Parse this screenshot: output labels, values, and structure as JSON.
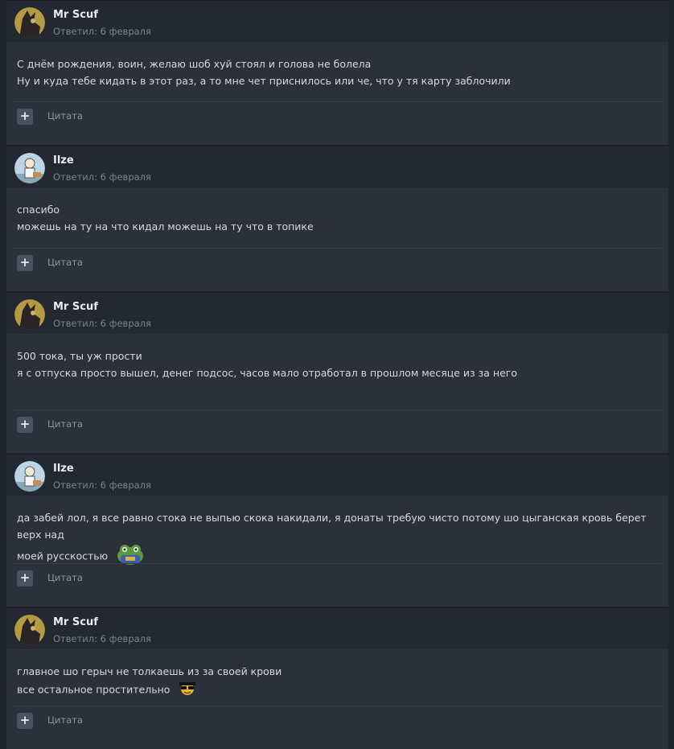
{
  "posts": [
    {
      "author": "Mr Scuf",
      "avatar": "dark-avatar",
      "meta": "Ответил: 6 февраля",
      "lines": [
        "С днём рождения, воин, желаю шоб хуй стоял и голова не болела",
        "Ну и куда тебе кидать в этот раз, а то мне чет приснилось или че, что у тя карту заблочили"
      ],
      "plus_label": "+",
      "quote_label": "Цитата"
    },
    {
      "author": "Ilze",
      "avatar": "cartoon-avatar",
      "meta": "Ответил: 6 февраля",
      "lines": [
        "спасибо",
        "можешь на ту на что кидал можешь на ту что в топике"
      ],
      "plus_label": "+",
      "quote_label": "Цитата"
    },
    {
      "author": "Mr Scuf",
      "avatar": "dark-avatar",
      "meta": "Ответил: 6 февраля",
      "lines": [
        "500 тока, ты уж прости",
        "я с отпуска просто вышел, денег подсос, часов мало отработал в прошлом месяце из за него"
      ],
      "plus_label": "+",
      "quote_label": "Цитата"
    },
    {
      "author": "Ilze",
      "avatar": "cartoon-avatar",
      "meta": "Ответил: 6 февраля",
      "lines": [
        "да забей лол, я все равно стока не выпью скока накидали, я донаты требую чисто потому шо цыганская кровь берет верх над",
        "моей русскостью"
      ],
      "emoji": "pepe-frog-emoji",
      "plus_label": "+",
      "quote_label": "Цитата"
    },
    {
      "author": "Mr Scuf",
      "avatar": "dark-avatar",
      "meta": "Ответил: 6 февраля",
      "lines": [
        "главное шо герыч не толкаешь из за своей крови",
        "все остальное простительно"
      ],
      "emoji": "sunglasses-emoji",
      "plus_label": "+",
      "quote_label": "Цитата"
    }
  ],
  "colors": {
    "page_bg": "#21252f",
    "post_bg": "#2b303b",
    "header_bg": "#242833",
    "button_bg": "#4a5160"
  }
}
